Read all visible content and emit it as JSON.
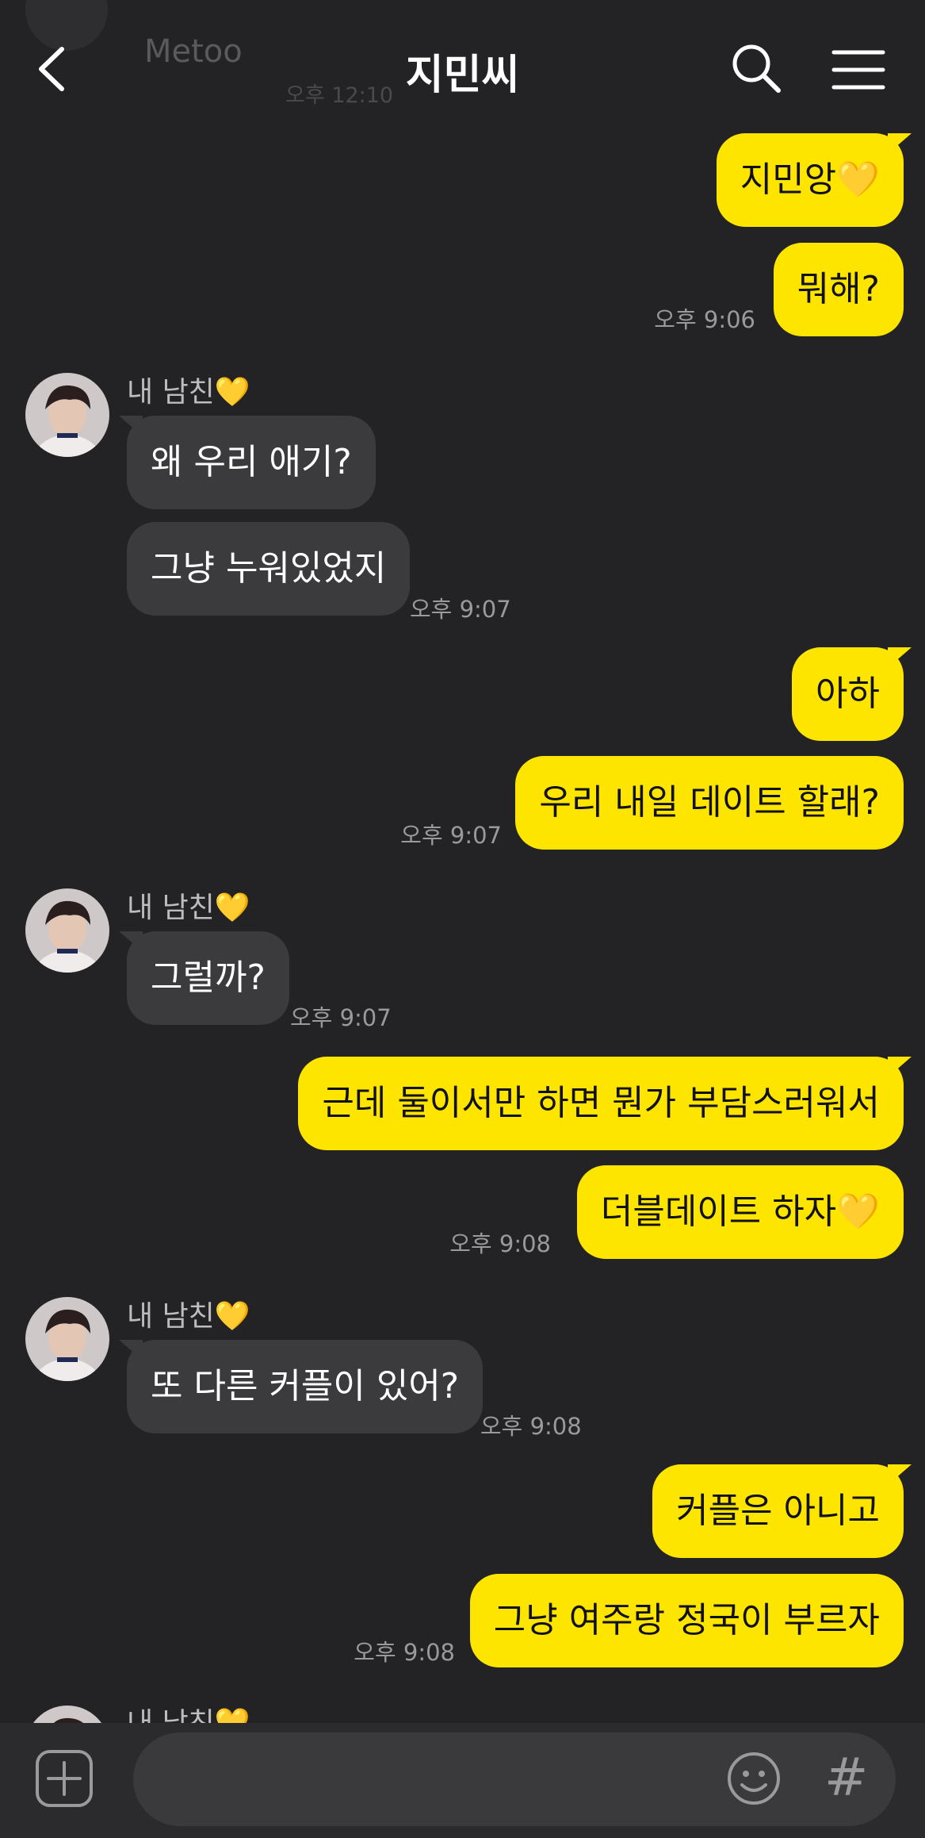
{
  "header": {
    "title": "지민씨",
    "faded_sender": "Metoo",
    "faded_time": "오후 12:10"
  },
  "sender_name": "내 남친💛",
  "messages": {
    "m1": "지민앙💛",
    "m2": "뭐해?",
    "t2": "오후 9:06",
    "m3": "왜 우리 애기?",
    "m4": "그냥 누워있었지",
    "t4": "오후 9:07",
    "m5": "아하",
    "m6": "우리 내일 데이트 할래?",
    "t6": "오후 9:07",
    "m7": "그럴까?",
    "t7": "오후 9:07",
    "m8": "근데 둘이서만 하면 뭔가 부담스러워서",
    "m9": "더블데이트 하자💛",
    "t9": "오후 9:08",
    "m10": "또 다른 커플이 있어?",
    "t10": "오후 9:08",
    "m11": "커플은 아니고",
    "m12": "그냥 여주랑 정국이 부르자",
    "t12": "오후 9:08"
  },
  "composer": {
    "placeholder": "",
    "hash_label": "#"
  },
  "colors": {
    "background": "#232325",
    "my_bubble": "#fee500",
    "their_bubble": "#3b3b3d",
    "timestamp": "#9a9a9c"
  },
  "icons": {
    "back": "chevron-left-icon",
    "search": "search-icon",
    "menu": "hamburger-menu-icon",
    "attach": "plus-square-icon",
    "emoji": "smiley-icon"
  }
}
